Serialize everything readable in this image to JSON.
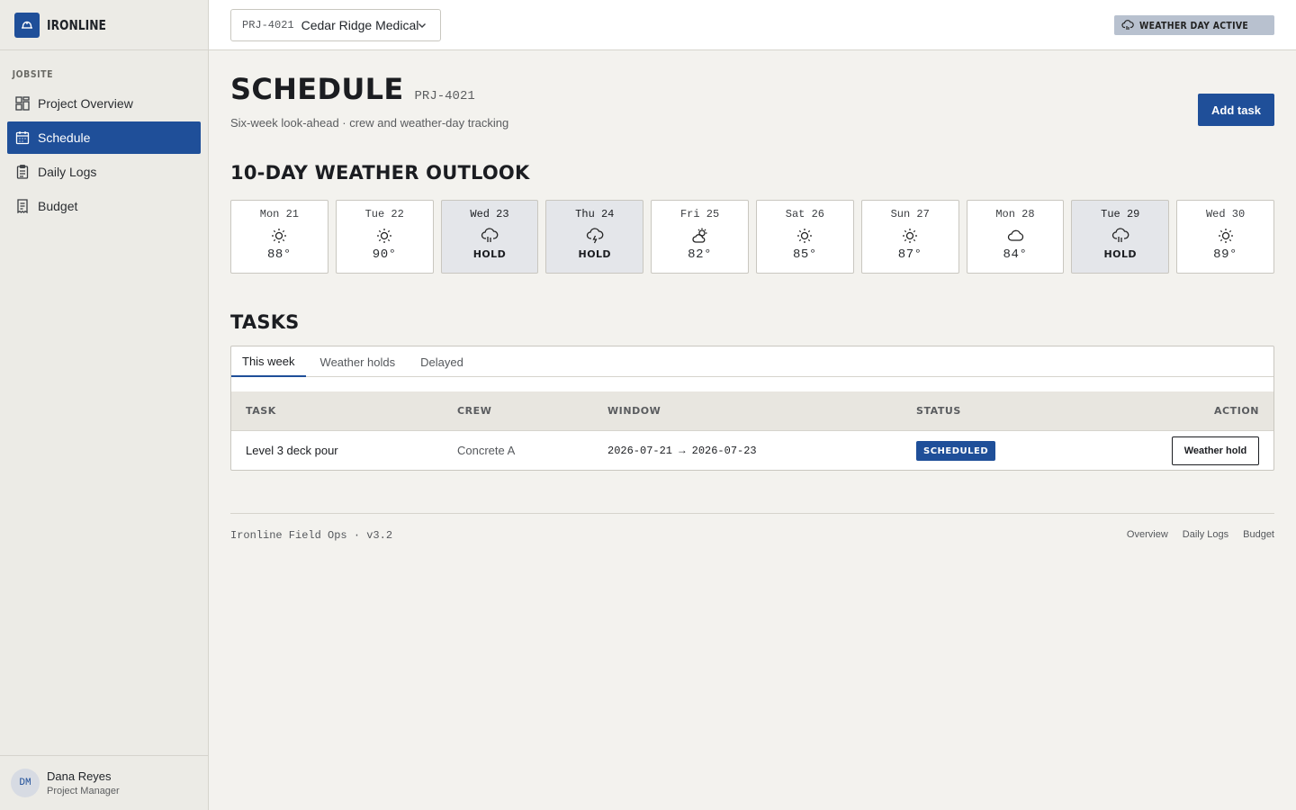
{
  "brand": {
    "name": "IRONLINE",
    "logo_icon": "hard-hat-icon"
  },
  "sidebar": {
    "section": "JOBSITE",
    "items": [
      {
        "label": "Project Overview",
        "icon": "dashboard-icon",
        "active": false
      },
      {
        "label": "Schedule",
        "icon": "calendar-icon",
        "active": true
      },
      {
        "label": "Daily Logs",
        "icon": "clipboard-icon",
        "active": false
      },
      {
        "label": "Budget",
        "icon": "receipt-icon",
        "active": false
      }
    ],
    "user": {
      "initials": "DM",
      "name": "Dana Reyes",
      "role": "Project Manager"
    }
  },
  "topbar": {
    "project_code": "PRJ-4021",
    "project_name": "Cedar Ridge Medical",
    "weather_badge": "WEATHER DAY ACTIVE"
  },
  "page": {
    "title": "SCHEDULE",
    "code": "PRJ-4021",
    "subtitle": "Six-week look-ahead · crew and weather-day tracking",
    "add_button": "Add task"
  },
  "weather": {
    "title": "10-DAY WEATHER OUTLOOK",
    "days": [
      {
        "label": "Mon 21",
        "icon": "sun-icon",
        "temp": "88°",
        "hold": false
      },
      {
        "label": "Tue 22",
        "icon": "sun-icon",
        "temp": "90°",
        "hold": false
      },
      {
        "label": "Wed 23",
        "icon": "rain-icon",
        "temp": "HOLD",
        "hold": true
      },
      {
        "label": "Thu 24",
        "icon": "storm-icon",
        "temp": "HOLD",
        "hold": true
      },
      {
        "label": "Fri 25",
        "icon": "partly-cloudy-icon",
        "temp": "82°",
        "hold": false
      },
      {
        "label": "Sat 26",
        "icon": "sun-icon",
        "temp": "85°",
        "hold": false
      },
      {
        "label": "Sun 27",
        "icon": "sun-icon",
        "temp": "87°",
        "hold": false
      },
      {
        "label": "Mon 28",
        "icon": "cloud-icon",
        "temp": "84°",
        "hold": false
      },
      {
        "label": "Tue 29",
        "icon": "rain-icon",
        "temp": "HOLD",
        "hold": true
      },
      {
        "label": "Wed 30",
        "icon": "sun-icon",
        "temp": "89°",
        "hold": false
      }
    ]
  },
  "tasks": {
    "title": "TASKS",
    "tabs": [
      "This week",
      "Weather holds",
      "Delayed"
    ],
    "active_tab": "This week",
    "columns": [
      "TASK",
      "CREW",
      "WINDOW",
      "STATUS",
      "ACTION"
    ],
    "rows": [
      {
        "task": "Level 3 deck pour",
        "crew": "Concrete A",
        "window": "2026-07-21 → 2026-07-23",
        "status": "SCHEDULED",
        "action": "Weather hold"
      }
    ]
  },
  "footer": {
    "text": "Ironline Field Ops · v3.2",
    "links": [
      "Overview",
      "Daily Logs",
      "Budget"
    ]
  }
}
